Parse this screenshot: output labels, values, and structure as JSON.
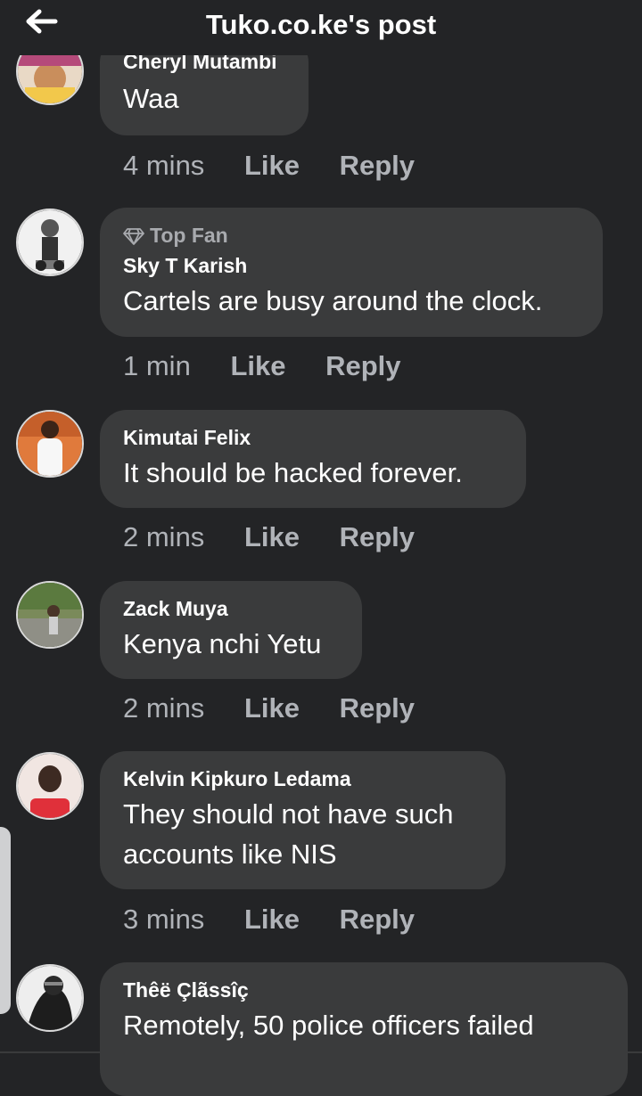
{
  "header": {
    "title": "Tuko.co.ke's post",
    "back_icon": "arrow-left-icon"
  },
  "comments": [
    {
      "author": "Cheryl Mutambi",
      "text": "Waa",
      "time": "4 mins",
      "like_label": "Like",
      "reply_label": "Reply"
    },
    {
      "badge": "Top Fan",
      "badge_icon": "diamond-icon",
      "author": "Sky T Karish",
      "text": "Cartels are busy around the clock.",
      "time": "1 min",
      "like_label": "Like",
      "reply_label": "Reply"
    },
    {
      "author": "Kimutai Felix",
      "text": "It should be hacked forever.",
      "time": "2 mins",
      "like_label": "Like",
      "reply_label": "Reply"
    },
    {
      "author": "Zack Muya",
      "text": "Kenya nchi Yetu",
      "time": "2 mins",
      "like_label": "Like",
      "reply_label": "Reply"
    },
    {
      "author": "Kelvin Kipkuro Ledama",
      "text_line1": "They should not have such",
      "text_line2": "accounts like NIS",
      "time": "3 mins",
      "like_label": "Like",
      "reply_label": "Reply"
    },
    {
      "author": "Thêë Çlãssîç",
      "text": "Remotely, 50 police officers failed"
    }
  ],
  "colors": {
    "background": "#232426",
    "bubble": "#3a3b3c",
    "meta_text": "#b0b3b8",
    "text": "#ffffff"
  }
}
